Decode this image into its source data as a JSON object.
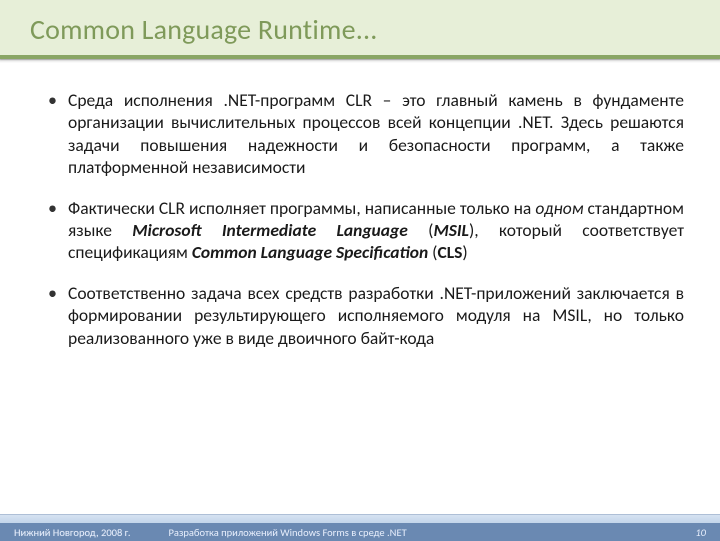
{
  "title": "Common Language Runtime...",
  "bullets": [
    {
      "pre": "Среда исполнения .NET-программ CLR – это главный камень в фундаменте организации вычислительных процессов всей концепции .NET. Здесь решаются задачи повышения надежности и безопасности программ, а также платформенной независимости"
    },
    {
      "pre": "Фактически CLR исполняет программы, написанные только на ",
      "em1": "одном",
      "mid1": " стандартном языке ",
      "bi1": "Microsoft Intermediate Language",
      "mid2": " (",
      "bi2": "MSIL",
      "mid3": "), который соответствует спецификациям ",
      "bi3": "Common Language Specification",
      "mid4": " (",
      "b1": "CLS",
      "post": ")"
    },
    {
      "pre": "Соответственно задача всех средств разработки .NET-приложений заключается в формировании результирующего исполняемого модуля на MSIL, но только реализованного уже в виде двоичного байт-кода"
    }
  ],
  "footer": {
    "left": "Нижний Новгород, 2008 г.",
    "center": "Разработка приложений Windows Forms в среде .NET",
    "page": "10"
  }
}
